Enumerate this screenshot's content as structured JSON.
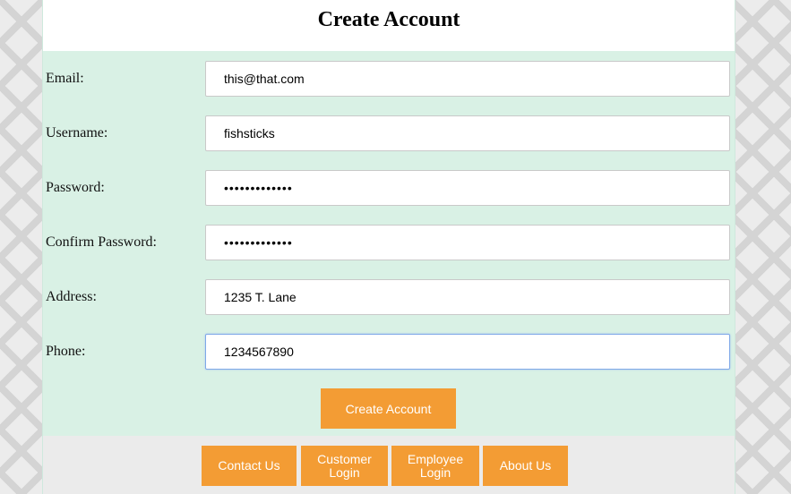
{
  "page": {
    "title": "Create Account"
  },
  "form": {
    "fields": [
      {
        "label": "Email:",
        "value": "this@that.com",
        "type": "text"
      },
      {
        "label": "Username:",
        "value": "fishsticks",
        "type": "text"
      },
      {
        "label": "Password:",
        "value": "fishsticks123",
        "type": "password"
      },
      {
        "label": "Confirm Password:",
        "value": "fishsticks123",
        "type": "password"
      },
      {
        "label": "Address:",
        "value": "1235 T. Lane",
        "type": "text"
      },
      {
        "label": "Phone:",
        "value": "1234567890",
        "type": "text"
      }
    ],
    "submit_label": "Create Account"
  },
  "footer": {
    "buttons": [
      {
        "label": "Contact Us"
      },
      {
        "label": "Customer\nLogin"
      },
      {
        "label": "Employee\nLogin"
      },
      {
        "label": "About Us"
      }
    ]
  },
  "colors": {
    "accent": "#f39c34",
    "form_background": "#d9f1e5",
    "footer_background": "#ebebeb"
  }
}
